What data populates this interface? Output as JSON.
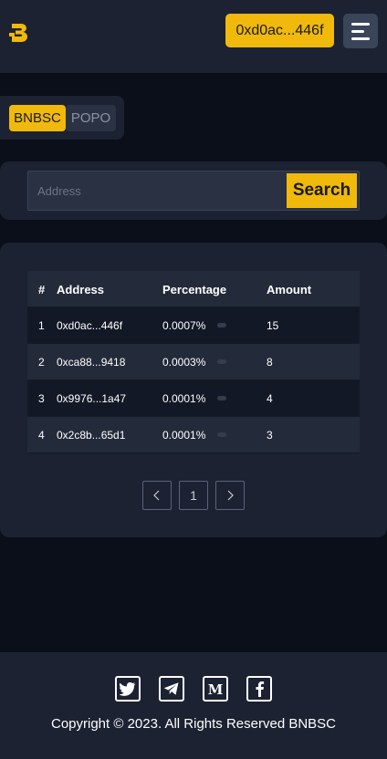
{
  "header": {
    "logo_icon": "bnbsc-logo-icon",
    "wallet_label": "0xd0ac...446f",
    "menu_icon": "hamburger-menu-icon"
  },
  "tabs": [
    {
      "label": "BNBSC",
      "active": true
    },
    {
      "label": "POPO",
      "active": false
    }
  ],
  "search": {
    "placeholder": "Address",
    "value": "",
    "button_label": "Search"
  },
  "table": {
    "columns": [
      "#",
      "Address",
      "Percentage",
      "Amount"
    ],
    "rows": [
      {
        "index": "1",
        "address": "0xd0ac...446f",
        "percentage": "0.0007%",
        "percentage_value": 0.0007,
        "amount": "15"
      },
      {
        "index": "2",
        "address": "0xca88...9418",
        "percentage": "0.0003%",
        "percentage_value": 0.0003,
        "amount": "8"
      },
      {
        "index": "3",
        "address": "0x9976...1a47",
        "percentage": "0.0001%",
        "percentage_value": 0.0001,
        "amount": "4"
      },
      {
        "index": "4",
        "address": "0x2c8b...65d1",
        "percentage": "0.0001%",
        "percentage_value": 0.0001,
        "amount": "3"
      }
    ]
  },
  "pagination": {
    "prev_icon": "chevron-left-icon",
    "current_page": "1",
    "next_icon": "chevron-right-icon"
  },
  "footer": {
    "social_icons": [
      "twitter-icon",
      "telegram-icon",
      "medium-icon",
      "facebook-icon"
    ],
    "copyright": "Copyright © 2023. All Rights Reserved BNBSC"
  },
  "colors": {
    "accent": "#f0b90b",
    "background": "#0a0f1a",
    "panel": "#1c2232"
  }
}
